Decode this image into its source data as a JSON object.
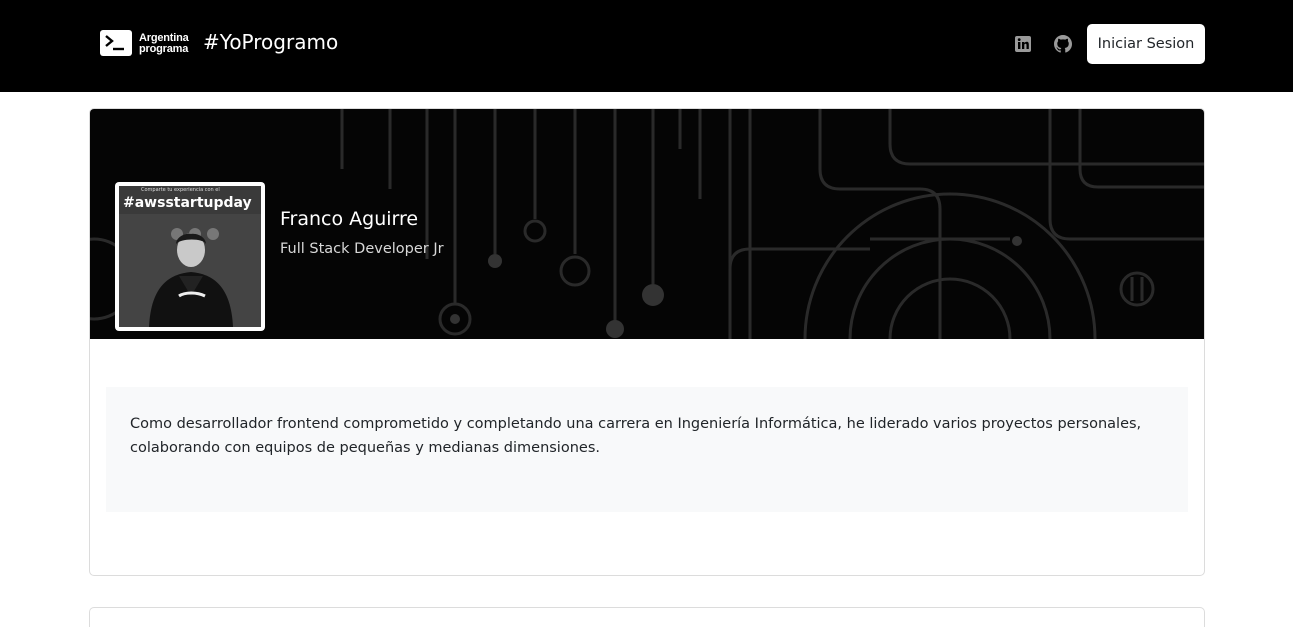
{
  "navbar": {
    "brand_line1": "Argentina",
    "brand_line2": "programa",
    "brand_tag": "#YoProgramo",
    "icons": [
      "linkedin-icon",
      "github-icon"
    ],
    "login_label": "Iniciar Sesion"
  },
  "profile": {
    "photo_small_text": "Comparte tu experiencia con el",
    "photo_headline": "#awsstartupday",
    "name": "Franco Aguirre",
    "role": "Full Stack Developer Jr",
    "about": "Como desarrollador frontend comprometido y completando una carrera en Ingeniería Informática, he liderado varios proyectos personales, colaborando con equipos de pequeñas y medianas dimensiones."
  },
  "colors": {
    "navbar_bg": "#000000",
    "banner_bg": "#050505",
    "about_bg": "#f8f9fa",
    "border": "#dcdcdc"
  }
}
